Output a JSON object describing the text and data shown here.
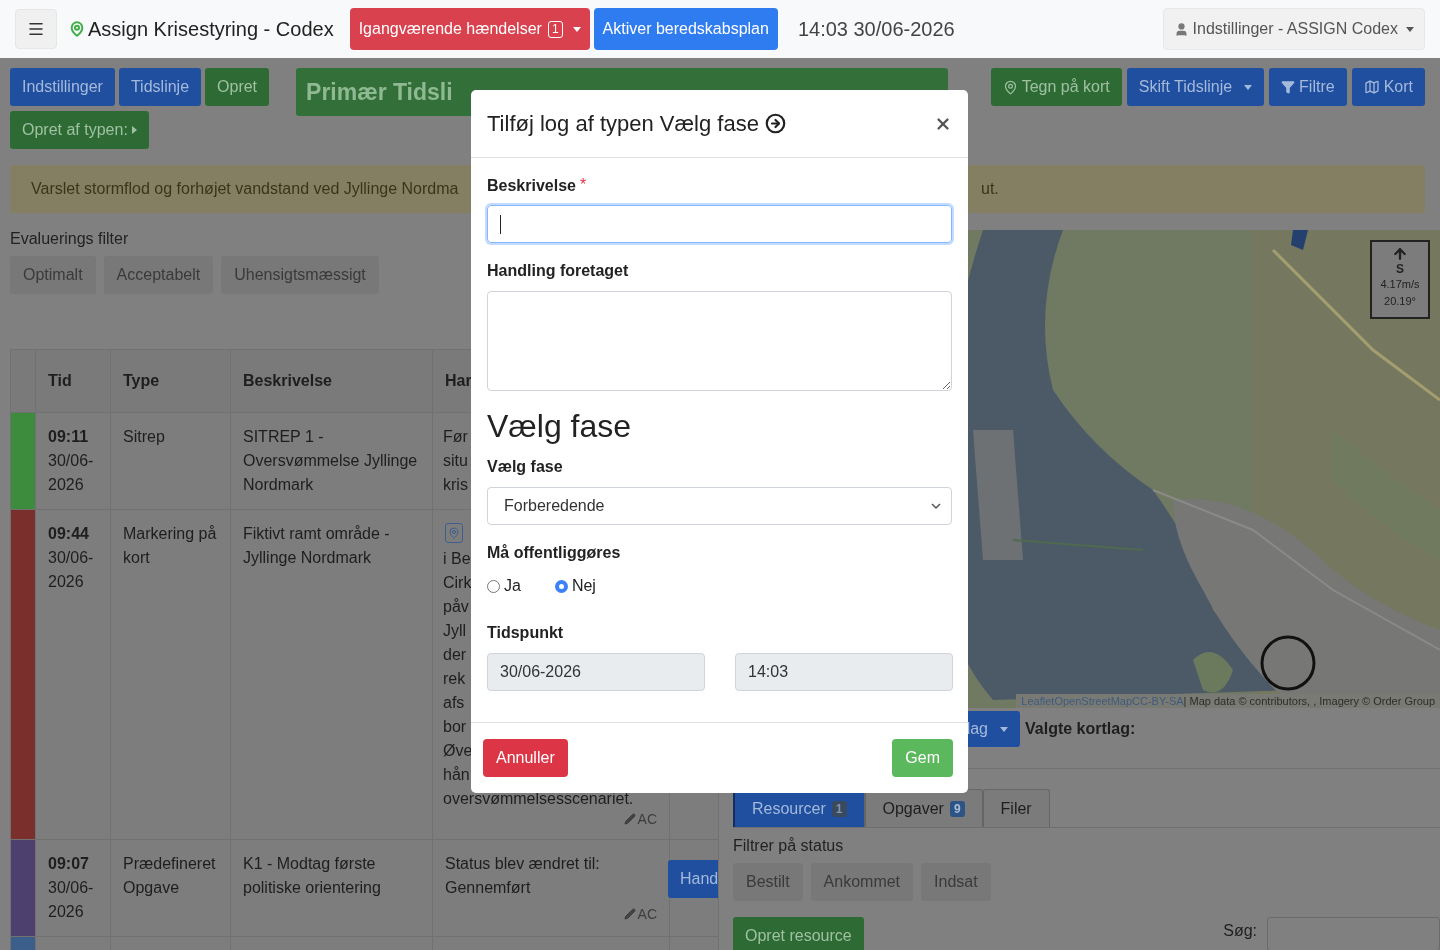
{
  "navbar": {
    "brand": "Assign Krisestyring - Codex",
    "incidents_button": {
      "label": "Igangværende hændelser",
      "count": "1"
    },
    "plan_button": "Aktiver beredskabsplan",
    "clock": "14:03 30/06-2026",
    "user_menu": "Indstillinger - ASSIGN Codex"
  },
  "toolbar": {
    "left_buttons": [
      {
        "label": "Indstillinger",
        "kind": "primary"
      },
      {
        "label": "Tidslinje",
        "kind": "primary"
      },
      {
        "label": "Opret",
        "kind": "success"
      }
    ],
    "title": "Primær Tidsli",
    "right_buttons": [
      {
        "label": "Tegn på kort",
        "kind": "success"
      },
      {
        "label": "Skift Tidslinje",
        "kind": "dropdown"
      },
      {
        "label": "Filtre",
        "kind": "primary"
      },
      {
        "label": "Kort",
        "kind": "primary"
      }
    ],
    "create_type_button": "Opret af typen:"
  },
  "alert": {
    "text_start": "Varslet stormflod og forhøjet vandstand ved Jyllinge Nordma",
    "text_end": "ut."
  },
  "evaluation_filter": {
    "label": "Evaluerings filter",
    "options": [
      "Optimalt",
      "Acceptabelt",
      "Uhensigtsmæssigt"
    ]
  },
  "table": {
    "columns": [
      "Tid",
      "Type",
      "Beskrivelse",
      "Har"
    ],
    "rows": [
      {
        "kind": "sitrep",
        "color": "#3d8b3d",
        "time": "09:11",
        "date": "30/06-2026",
        "type": "Sitrep",
        "description": "SITREP 1 - Oversvømmelse Jyllinge Nordmark",
        "handling_lines": [
          "Før",
          "situ",
          "kris"
        ]
      },
      {
        "kind": "map",
        "color": "#7a2f2c",
        "time": "09:44",
        "date": "30/06-2026",
        "type": "Markering på kort",
        "description": "Fiktivt ramt område - Jyllinge Nordmark",
        "handling_lines": [
          "i Be",
          "Cirk",
          "påv",
          "Jyll",
          "der",
          "rek",
          "afs",
          "bor",
          "Øve",
          "hån",
          "oversvømmelsesscenariet."
        ],
        "author": "AC"
      },
      {
        "kind": "task",
        "color": "#4d3f6e",
        "time": "09:07",
        "date": "30/06-2026",
        "type": "Prædefineret Opgave",
        "description": "K1 - Modtag første politiske orientering",
        "handling": "Status blev ændret til: Gennemført",
        "author": "AC",
        "button": "Hand"
      },
      {
        "kind": "task",
        "color": "#3b5f8a"
      }
    ]
  },
  "map": {
    "wind": {
      "direction": "S",
      "speed": "4.17m/s",
      "degrees": "20.19°"
    },
    "attribution": {
      "links": [
        "Leaflet",
        "OpenStreetMap",
        "CC-BY-SA"
      ],
      "text": "| Map data © contributors, , Imagery © Order Group"
    }
  },
  "layers_button": "lag",
  "selected_layers_label": "Valgte kortlag:",
  "tabs": [
    {
      "label": "Resourcer",
      "count": "1",
      "selected": true
    },
    {
      "label": "Opgaver",
      "count": "9",
      "selected": false
    },
    {
      "label": "Filer",
      "selected": false
    }
  ],
  "status_filter": {
    "label": "Filtrer på status",
    "options": [
      "Bestilt",
      "Ankommet",
      "Indsat"
    ]
  },
  "create_resource_button": "Opret resource",
  "search": {
    "label": "Søg:"
  },
  "modal": {
    "title": "Tilføj log af typen Vælg fase",
    "description": {
      "label": "Beskrivelse",
      "required_mark": "*",
      "focused": true
    },
    "action": {
      "label": "Handling foretaget"
    },
    "section_heading": "Vælg fase",
    "phase": {
      "label": "Vælg fase",
      "value": "Forberedende"
    },
    "publish": {
      "label": "Må offentliggøres",
      "options": [
        {
          "label": "Ja",
          "selected": false
        },
        {
          "label": "Nej",
          "selected": true
        }
      ]
    },
    "timestamp": {
      "label": "Tidspunkt",
      "date": "30/06-2026",
      "time": "14:03"
    },
    "cancel_button": "Annuller",
    "save_button": "Gem"
  }
}
